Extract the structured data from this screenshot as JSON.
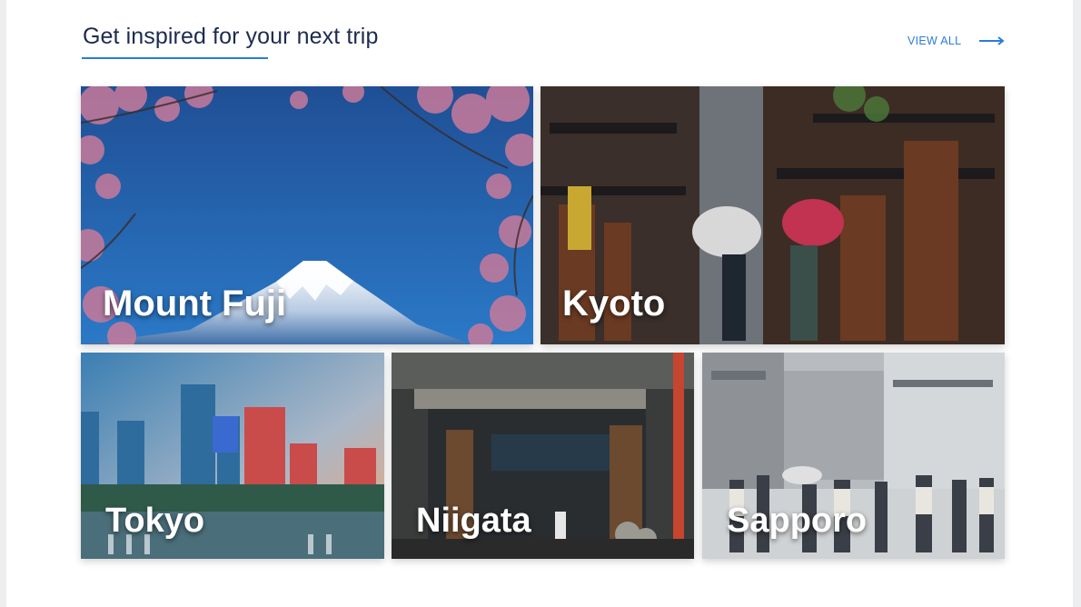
{
  "section": {
    "title": "Get inspired for your next trip",
    "view_all_label": "VIEW ALL"
  },
  "icons": {
    "view_all": "arrow-right-icon"
  },
  "colors": {
    "accent": "#2a7dd8",
    "heading": "#1d2b4f"
  },
  "destinations": [
    {
      "name": "Mount Fuji"
    },
    {
      "name": "Kyoto"
    },
    {
      "name": "Tokyo"
    },
    {
      "name": "Niigata"
    },
    {
      "name": "Sapporo"
    }
  ]
}
